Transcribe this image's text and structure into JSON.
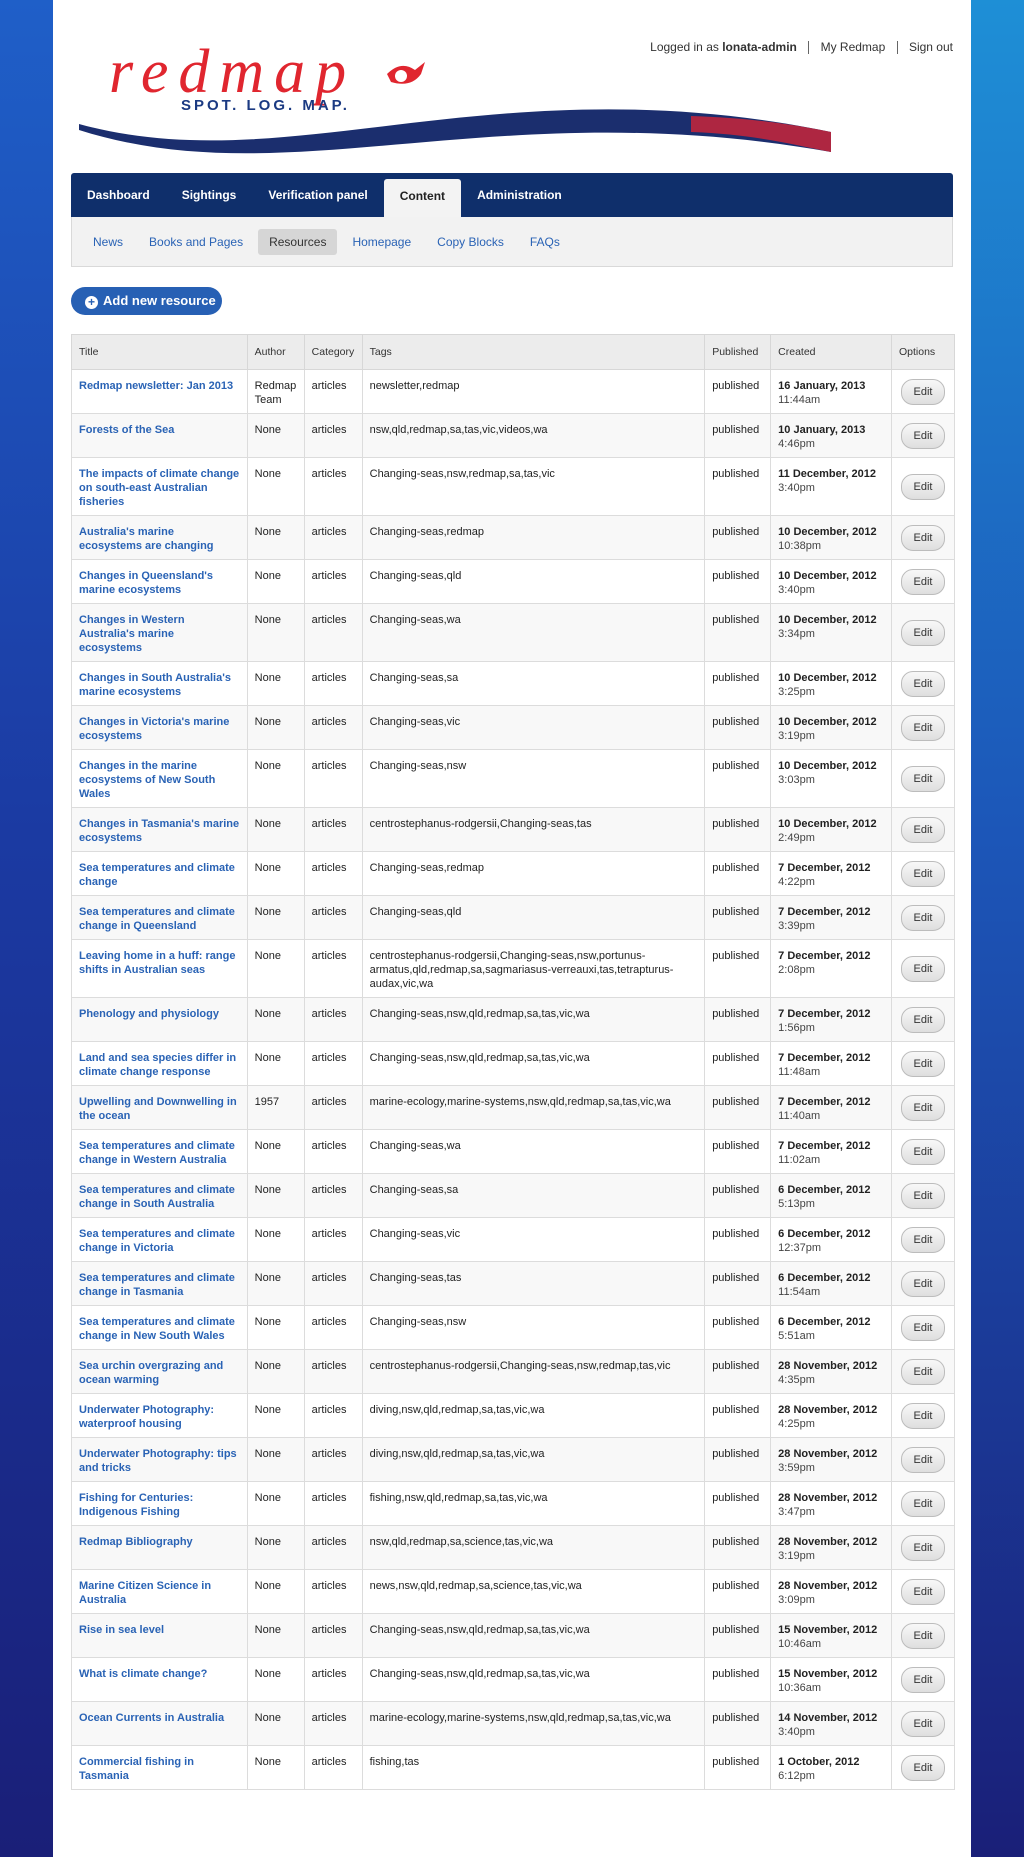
{
  "userbar": {
    "logged_prefix": "Logged in as",
    "username": "lonata-admin",
    "my_redmap": "My Redmap",
    "sign_out": "Sign out"
  },
  "logo": {
    "wordmark": "redmap",
    "tagline": "SPOT. LOG. MAP."
  },
  "mainnav": [
    "Dashboard",
    "Sightings",
    "Verification panel",
    "Content",
    "Administration"
  ],
  "mainnav_active": "Content",
  "subnav": [
    "News",
    "Books and Pages",
    "Resources",
    "Homepage",
    "Copy Blocks",
    "FAQs"
  ],
  "subnav_active": "Resources",
  "add_button": "Add new resource",
  "table": {
    "headers": [
      "Title",
      "Author",
      "Category",
      "Tags",
      "Published",
      "Created",
      "Options"
    ],
    "edit_label": "Edit",
    "rows": [
      {
        "title": "Redmap newsletter: Jan 2013",
        "author": "Redmap Team",
        "category": "articles",
        "tags": "newsletter,redmap",
        "published": "published",
        "date": "16 January, 2013",
        "time": "11:44am"
      },
      {
        "title": "Forests of the Sea",
        "author": "None",
        "category": "articles",
        "tags": "nsw,qld,redmap,sa,tas,vic,videos,wa",
        "published": "published",
        "date": "10 January, 2013",
        "time": "4:46pm"
      },
      {
        "title": "The impacts of climate change on south-east Australian fisheries",
        "author": "None",
        "category": "articles",
        "tags": "Changing-seas,nsw,redmap,sa,tas,vic",
        "published": "published",
        "date": "11 December, 2012",
        "time": "3:40pm"
      },
      {
        "title": "Australia's marine ecosystems are changing",
        "author": "None",
        "category": "articles",
        "tags": "Changing-seas,redmap",
        "published": "published",
        "date": "10 December, 2012",
        "time": "10:38pm"
      },
      {
        "title": "Changes in Queensland's marine ecosystems",
        "author": "None",
        "category": "articles",
        "tags": "Changing-seas,qld",
        "published": "published",
        "date": "10 December, 2012",
        "time": "3:40pm"
      },
      {
        "title": "Changes in Western Australia's marine ecosystems",
        "author": "None",
        "category": "articles",
        "tags": "Changing-seas,wa",
        "published": "published",
        "date": "10 December, 2012",
        "time": "3:34pm"
      },
      {
        "title": "Changes in South Australia's marine ecosystems",
        "author": "None",
        "category": "articles",
        "tags": "Changing-seas,sa",
        "published": "published",
        "date": "10 December, 2012",
        "time": "3:25pm"
      },
      {
        "title": "Changes in Victoria's marine ecosystems",
        "author": "None",
        "category": "articles",
        "tags": "Changing-seas,vic",
        "published": "published",
        "date": "10 December, 2012",
        "time": "3:19pm"
      },
      {
        "title": "Changes in the marine ecosystems of New South Wales",
        "author": "None",
        "category": "articles",
        "tags": "Changing-seas,nsw",
        "published": "published",
        "date": "10 December, 2012",
        "time": "3:03pm"
      },
      {
        "title": "Changes in Tasmania's marine ecosystems",
        "author": "None",
        "category": "articles",
        "tags": "centrostephanus-rodgersii,Changing-seas,tas",
        "published": "published",
        "date": "10 December, 2012",
        "time": "2:49pm"
      },
      {
        "title": "Sea temperatures and climate change",
        "author": "None",
        "category": "articles",
        "tags": "Changing-seas,redmap",
        "published": "published",
        "date": "7 December, 2012",
        "time": "4:22pm"
      },
      {
        "title": "Sea temperatures and climate change in Queensland",
        "author": "None",
        "category": "articles",
        "tags": "Changing-seas,qld",
        "published": "published",
        "date": "7 December, 2012",
        "time": "3:39pm"
      },
      {
        "title": "Leaving home in a huff: range shifts in Australian seas",
        "author": "None",
        "category": "articles",
        "tags": "centrostephanus-rodgersii,Changing-seas,nsw,portunus-armatus,qld,redmap,sa,sagmariasus-verreauxi,tas,tetrapturus-audax,vic,wa",
        "published": "published",
        "date": "7 December, 2012",
        "time": "2:08pm"
      },
      {
        "title": "Phenology and physiology",
        "author": "None",
        "category": "articles",
        "tags": "Changing-seas,nsw,qld,redmap,sa,tas,vic,wa",
        "published": "published",
        "date": "7 December, 2012",
        "time": "1:56pm"
      },
      {
        "title": "Land and sea species differ in climate change response",
        "author": "None",
        "category": "articles",
        "tags": "Changing-seas,nsw,qld,redmap,sa,tas,vic,wa",
        "published": "published",
        "date": "7 December, 2012",
        "time": "11:48am"
      },
      {
        "title": "Upwelling and Downwelling in the ocean",
        "author": "1957",
        "category": "articles",
        "tags": "marine-ecology,marine-systems,nsw,qld,redmap,sa,tas,vic,wa",
        "published": "published",
        "date": "7 December, 2012",
        "time": "11:40am"
      },
      {
        "title": "Sea temperatures and climate change in Western Australia",
        "author": "None",
        "category": "articles",
        "tags": "Changing-seas,wa",
        "published": "published",
        "date": "7 December, 2012",
        "time": "11:02am"
      },
      {
        "title": "Sea temperatures and climate change in South Australia",
        "author": "None",
        "category": "articles",
        "tags": "Changing-seas,sa",
        "published": "published",
        "date": "6 December, 2012",
        "time": "5:13pm"
      },
      {
        "title": "Sea temperatures and climate change in Victoria",
        "author": "None",
        "category": "articles",
        "tags": "Changing-seas,vic",
        "published": "published",
        "date": "6 December, 2012",
        "time": "12:37pm"
      },
      {
        "title": "Sea temperatures and climate change in Tasmania",
        "author": "None",
        "category": "articles",
        "tags": "Changing-seas,tas",
        "published": "published",
        "date": "6 December, 2012",
        "time": "11:54am"
      },
      {
        "title": "Sea temperatures and climate change in New South Wales",
        "author": "None",
        "category": "articles",
        "tags": "Changing-seas,nsw",
        "published": "published",
        "date": "6 December, 2012",
        "time": "5:51am"
      },
      {
        "title": "Sea urchin overgrazing and ocean warming",
        "author": "None",
        "category": "articles",
        "tags": "centrostephanus-rodgersii,Changing-seas,nsw,redmap,tas,vic",
        "published": "published",
        "date": "28 November, 2012",
        "time": "4:35pm"
      },
      {
        "title": "Underwater Photography: waterproof housing",
        "author": "None",
        "category": "articles",
        "tags": "diving,nsw,qld,redmap,sa,tas,vic,wa",
        "published": "published",
        "date": "28 November, 2012",
        "time": "4:25pm"
      },
      {
        "title": "Underwater Photography: tips and tricks",
        "author": "None",
        "category": "articles",
        "tags": "diving,nsw,qld,redmap,sa,tas,vic,wa",
        "published": "published",
        "date": "28 November, 2012",
        "time": "3:59pm"
      },
      {
        "title": "Fishing for Centuries: Indigenous Fishing",
        "author": "None",
        "category": "articles",
        "tags": "fishing,nsw,qld,redmap,sa,tas,vic,wa",
        "published": "published",
        "date": "28 November, 2012",
        "time": "3:47pm"
      },
      {
        "title": "Redmap Bibliography",
        "author": "None",
        "category": "articles",
        "tags": "nsw,qld,redmap,sa,science,tas,vic,wa",
        "published": "published",
        "date": "28 November, 2012",
        "time": "3:19pm"
      },
      {
        "title": "Marine Citizen Science in Australia",
        "author": "None",
        "category": "articles",
        "tags": "news,nsw,qld,redmap,sa,science,tas,vic,wa",
        "published": "published",
        "date": "28 November, 2012",
        "time": "3:09pm"
      },
      {
        "title": "Rise in sea level",
        "author": "None",
        "category": "articles",
        "tags": "Changing-seas,nsw,qld,redmap,sa,tas,vic,wa",
        "published": "published",
        "date": "15 November, 2012",
        "time": "10:46am"
      },
      {
        "title": "What is climate change?",
        "author": "None",
        "category": "articles",
        "tags": "Changing-seas,nsw,qld,redmap,sa,tas,vic,wa",
        "published": "published",
        "date": "15 November, 2012",
        "time": "10:36am"
      },
      {
        "title": "Ocean Currents in Australia",
        "author": "None",
        "category": "articles",
        "tags": "marine-ecology,marine-systems,nsw,qld,redmap,sa,tas,vic,wa",
        "published": "published",
        "date": "14 November, 2012",
        "time": "3:40pm"
      },
      {
        "title": "Commercial fishing in Tasmania",
        "author": "None",
        "category": "articles",
        "tags": "fishing,tas",
        "published": "published",
        "date": "1 October, 2012",
        "time": "6:12pm"
      }
    ]
  },
  "colors": {
    "nav_bg": "#0f2f6b",
    "link": "#2a63b5",
    "brand_red": "#e0262f",
    "brand_blue": "#1b3a82"
  }
}
